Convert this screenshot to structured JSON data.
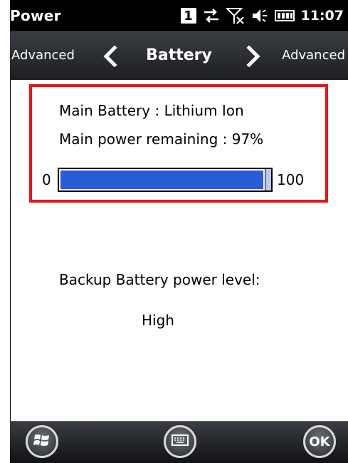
{
  "status_bar": {
    "app_title": "Power",
    "badge": "1",
    "time": "11:07",
    "icons": [
      "notification-badge-icon",
      "connectivity-icon",
      "signal-off-icon",
      "speaker-icon",
      "battery-icon"
    ]
  },
  "nav": {
    "title": "Battery",
    "prev_label": "Advanced",
    "next_label": "Advanced"
  },
  "main": {
    "battery_type_line": "Main Battery : Lithium Ion",
    "power_remaining_line": "Main power remaining : 97%",
    "bar_min": "0",
    "bar_max": "100",
    "power_remaining_value": 97,
    "backup_label": "Backup Battery power level:",
    "backup_value": "High"
  },
  "bottom_bar": {
    "ok_label": "OK",
    "icons": [
      "windows-start-icon",
      "keyboard-icon"
    ]
  },
  "colors": {
    "highlight_border": "#e8141b",
    "bar_fill": "#2a5bd7",
    "bar_end": "#b9c8f1"
  }
}
